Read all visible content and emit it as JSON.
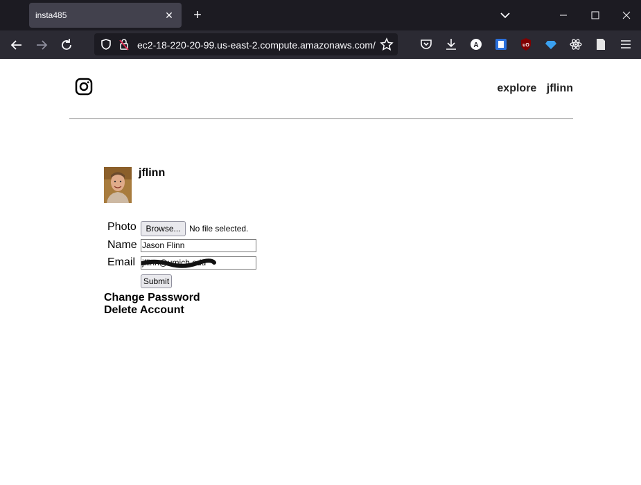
{
  "browser": {
    "tab_title": "insta485",
    "url": "ec2-18-220-20-99.us-east-2.compute.amazonaws.com/"
  },
  "header": {
    "nav_explore": "explore",
    "nav_user": "jflinn"
  },
  "profile": {
    "username": "jflinn"
  },
  "form": {
    "photo_label": "Photo",
    "browse_label": "Browse...",
    "no_file_text": "No file selected.",
    "name_label": "Name",
    "name_value": "Jason Flinn",
    "email_label": "Email",
    "email_value": "jflinn@umich.edu",
    "submit_label": "Submit"
  },
  "links": {
    "change_password": "Change Password",
    "delete_account": "Delete Account"
  },
  "colors": {
    "tabbar_bg": "#1c1b22",
    "navbar_bg": "#2b2a33",
    "tab_active_bg": "#42414d"
  }
}
